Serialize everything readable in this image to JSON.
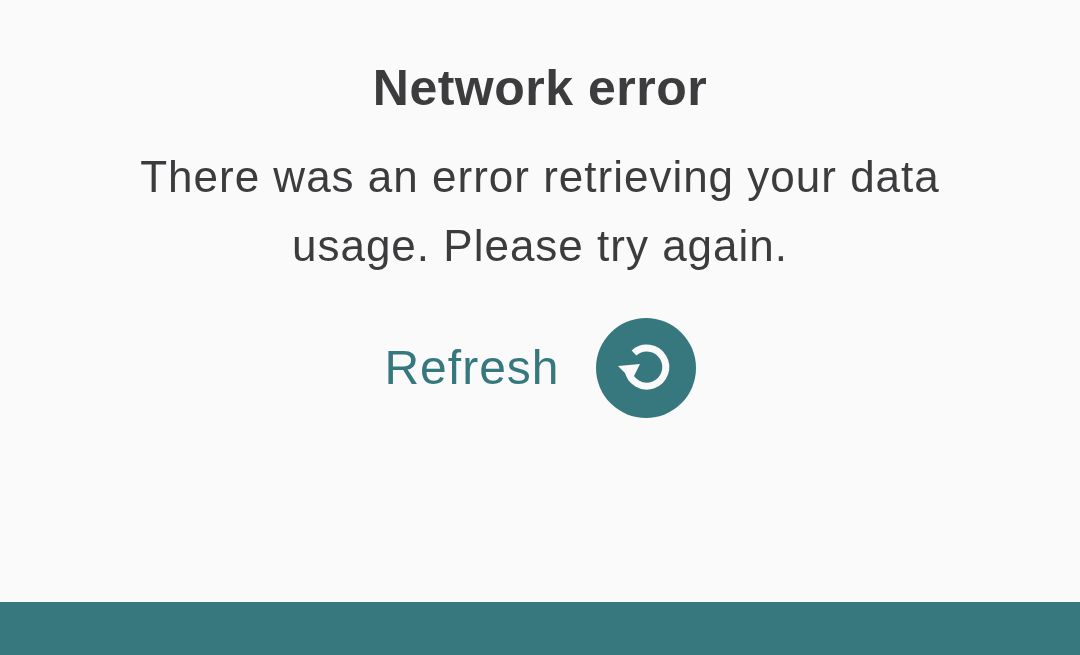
{
  "title": "Network error",
  "message": "There was an error retrieving your data usage. Please try again.",
  "refresh_button": {
    "label": "Refresh"
  }
}
